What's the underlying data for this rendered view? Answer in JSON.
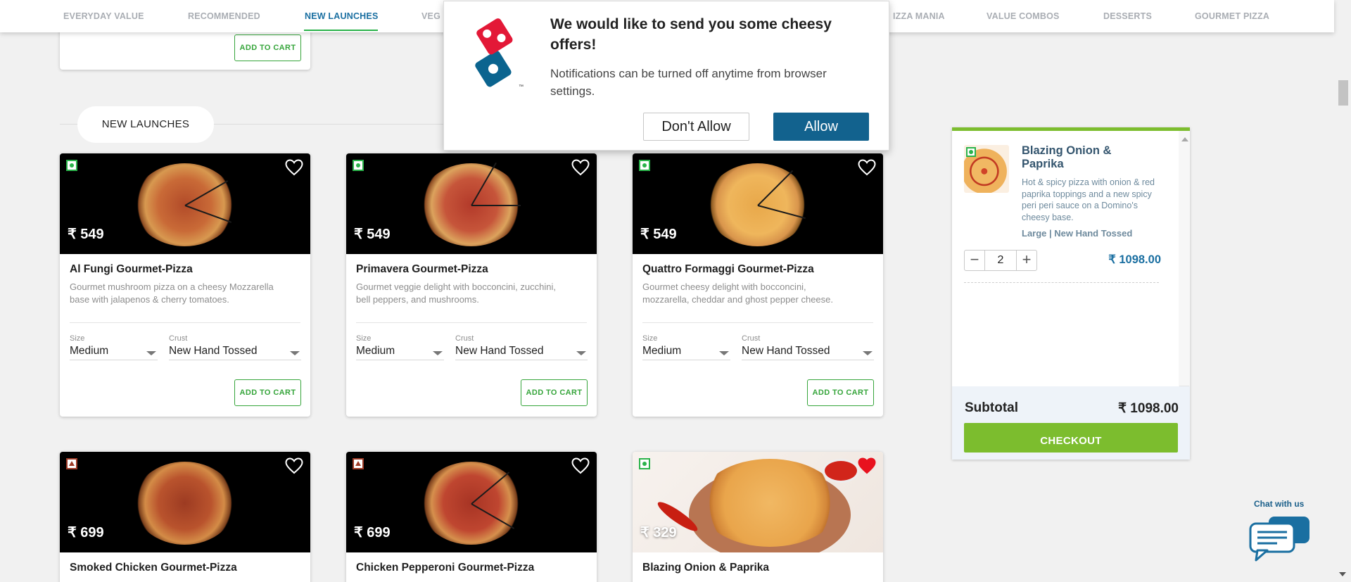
{
  "topnav": {
    "tabs": [
      {
        "label": "EVERYDAY VALUE"
      },
      {
        "label": "RECOMMENDED"
      },
      {
        "label": "NEW LAUNCHES"
      },
      {
        "label": "VEG"
      },
      {
        "label": "IZZA MANIA"
      },
      {
        "label": "VALUE COMBOS"
      },
      {
        "label": "DESSERTS"
      },
      {
        "label": "GOURMET PIZZA"
      }
    ],
    "active_tab": "NEW LAUNCHES"
  },
  "top_partial_card": {
    "add_label": "ADD TO CART"
  },
  "section": {
    "label": "NEW LAUNCHES"
  },
  "cards": [
    {
      "type": "veg",
      "price": "₹ 549",
      "title": "Al Fungi Gourmet-Pizza",
      "desc": "Gourmet mushroom pizza on a cheesy Mozzarella base with jalapenos & cherry tomatoes.",
      "size_label": "Size",
      "size_value": "Medium",
      "crust_label": "Crust",
      "crust_value": "New Hand Tossed",
      "add_label": "ADD TO CART",
      "favorited": false
    },
    {
      "type": "veg",
      "price": "₹ 549",
      "title": "Primavera Gourmet-Pizza",
      "desc": "Gourmet veggie delight with bocconcini, zucchini, bell peppers, and mushrooms.",
      "size_label": "Size",
      "size_value": "Medium",
      "crust_label": "Crust",
      "crust_value": "New Hand Tossed",
      "add_label": "ADD TO CART",
      "favorited": false
    },
    {
      "type": "veg",
      "price": "₹ 549",
      "title": "Quattro Formaggi Gourmet-Pizza",
      "desc": "Gourmet cheesy delight with bocconcini, mozzarella, cheddar and ghost pepper cheese.",
      "size_label": "Size",
      "size_value": "Medium",
      "crust_label": "Crust",
      "crust_value": "New Hand Tossed",
      "add_label": "ADD TO CART",
      "favorited": false
    },
    {
      "type": "nonveg",
      "price": "₹ 699",
      "title": "Smoked Chicken Gourmet-Pizza",
      "favorited": false
    },
    {
      "type": "nonveg",
      "price": "₹ 699",
      "title": "Chicken Pepperoni Gourmet-Pizza",
      "favorited": false
    },
    {
      "type": "veg",
      "price": "₹ 329",
      "title": "Blazing Onion & Paprika",
      "favorited": true
    }
  ],
  "notification": {
    "title": "We would like to send you some cheesy offers!",
    "subtitle": "Notifications can be turned off anytime from browser settings.",
    "deny_label": "Don't Allow",
    "allow_label": "Allow",
    "logo_mark": "™"
  },
  "cart": {
    "item_name": "Blazing Onion & Paprika",
    "item_desc": "Hot & spicy pizza with onion & red paprika toppings and a new spicy peri peri sauce on a Domino's cheesy base.",
    "item_opts": "Large | New Hand Tossed",
    "quantity": "2",
    "minus": "−",
    "plus": "+",
    "item_price": "₹ 1098.00",
    "subtotal_label": "Subtotal",
    "subtotal_value": "₹ 1098.00",
    "checkout_label": "CHECKOUT"
  },
  "chat": {
    "label": "Chat with us"
  },
  "colors": {
    "accent_blue": "#1a6fa1",
    "brand_green": "#7cbd2e",
    "add_green": "#36a53b",
    "allow_blue": "#12628e",
    "heart_red": "#e8121e"
  }
}
